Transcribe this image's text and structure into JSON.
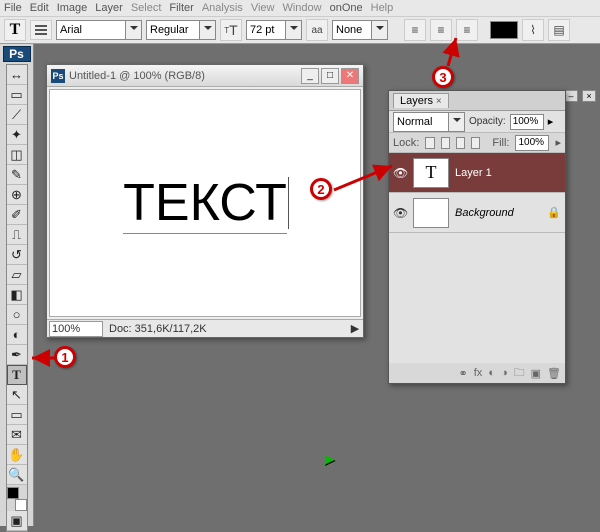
{
  "menu": [
    "File",
    "Edit",
    "Image",
    "Layer",
    "Select",
    "Filter",
    "Analysis",
    "View",
    "Window",
    "onOne",
    "Help"
  ],
  "options": {
    "font": "Arial",
    "weight": "Regular",
    "sizeLabel": "T",
    "size": "72 pt",
    "aa": "aa",
    "aaMode": "None"
  },
  "doc": {
    "title": "Untitled-1 @ 100% (RGB/8)",
    "text": "ТЕКСТ",
    "zoom": "100%",
    "info": "Doc: 351,6K/117,2K"
  },
  "layers": {
    "tab": "Layers",
    "blend": "Normal",
    "opacityLabel": "Opacity:",
    "opacity": "100%",
    "lockLabel": "Lock:",
    "fillLabel": "Fill:",
    "fill": "100%",
    "rows": [
      {
        "thumb": "T",
        "name": "Layer 1",
        "locked": false,
        "selected": true
      },
      {
        "thumb": "",
        "name": "Background",
        "locked": true,
        "selected": false
      }
    ]
  },
  "tools": [
    "▭",
    "⤢",
    "✂",
    "◧",
    "◨",
    "✎",
    "✐",
    "⎌",
    "⌫",
    "▤",
    "◐",
    "♒",
    "✍",
    "T",
    "◺",
    "▭",
    "✥",
    "✋",
    "🔍"
  ],
  "callouts": {
    "c1": "1",
    "c2": "2",
    "c3": "3"
  }
}
